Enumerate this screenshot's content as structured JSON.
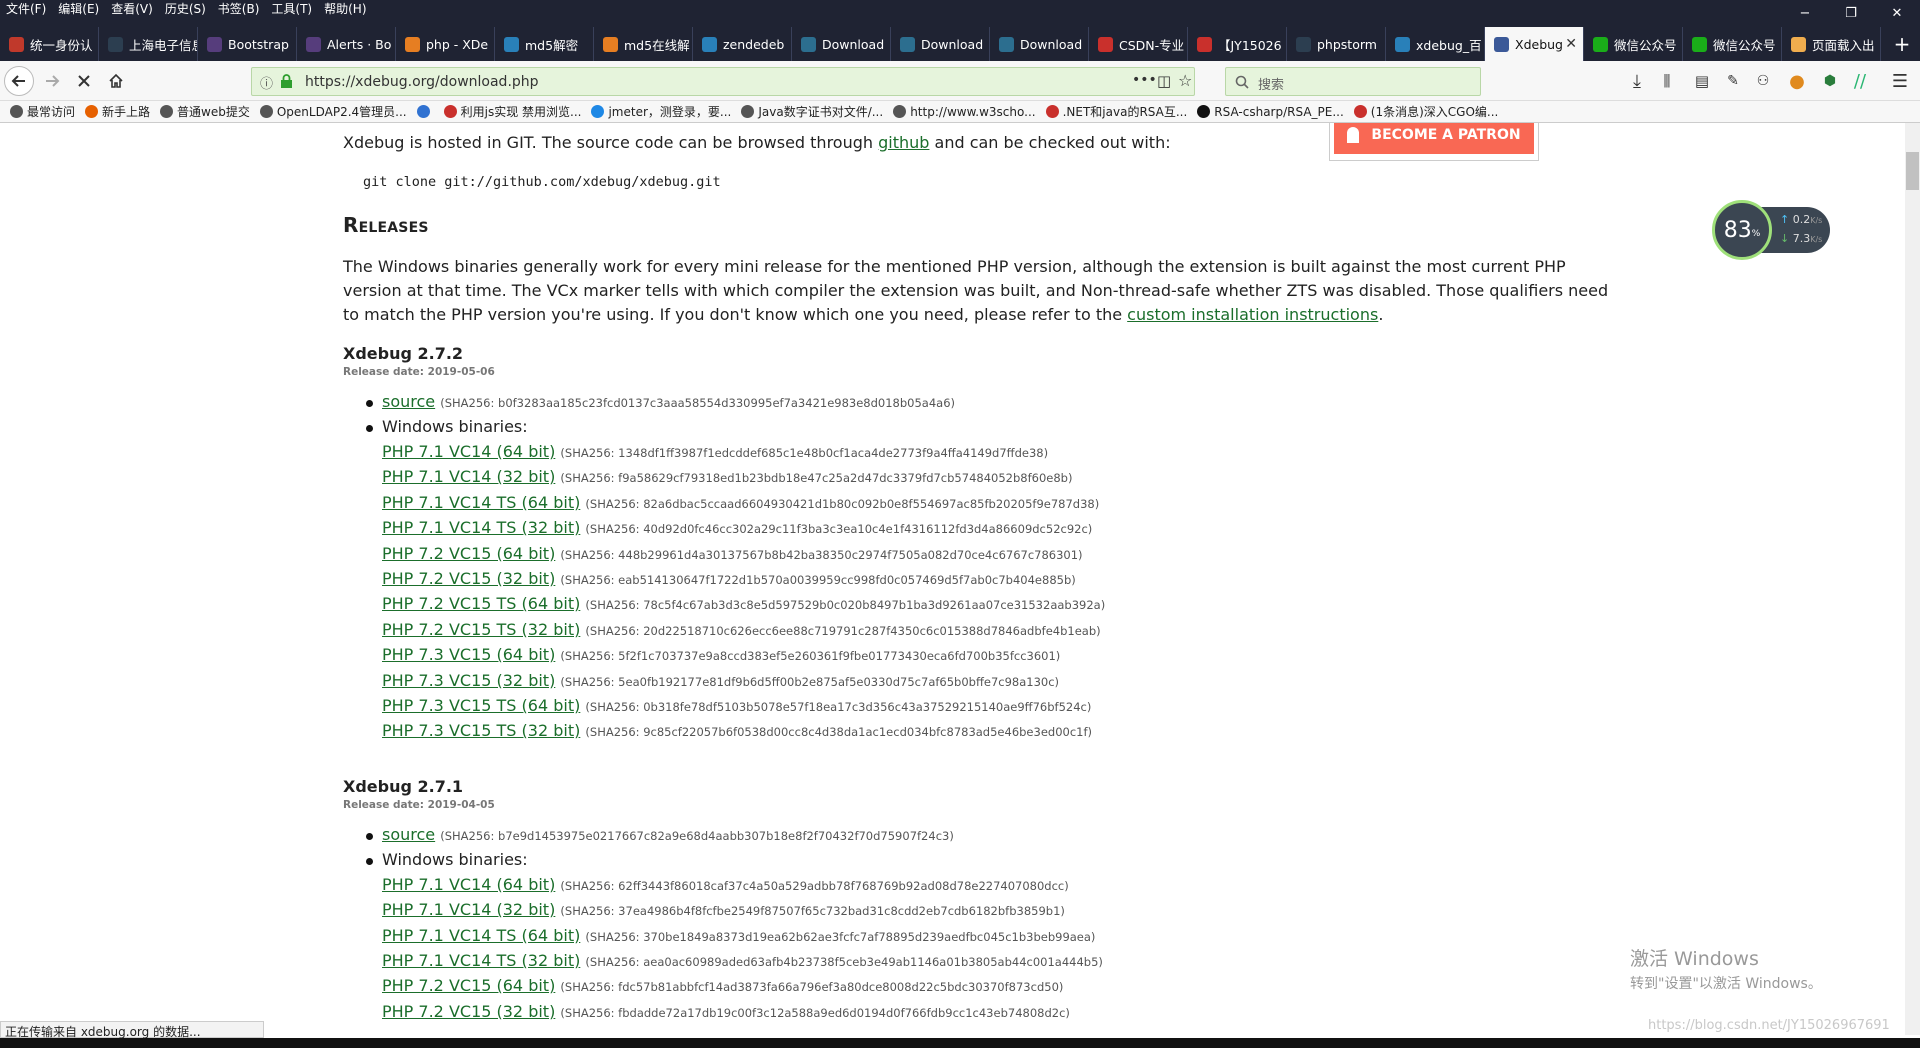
{
  "menu": [
    "文件(F)",
    "编辑(E)",
    "查看(V)",
    "历史(S)",
    "书签(B)",
    "工具(T)",
    "帮助(H)"
  ],
  "window_controls": {
    "minimize": "−",
    "restore": "❐",
    "close": "✕"
  },
  "tabs": [
    {
      "title": "统一身份认",
      "fav": "#c0392b"
    },
    {
      "title": "上海电子信息职",
      "fav": "#2c3e50"
    },
    {
      "title": "Bootstrap",
      "fav": "#563d7c"
    },
    {
      "title": "Alerts · Bo",
      "fav": "#563d7c"
    },
    {
      "title": "php - XDe",
      "fav": "#e67e22"
    },
    {
      "title": "md5解密",
      "fav": "#2980b9"
    },
    {
      "title": "md5在线解",
      "fav": "#e67e22"
    },
    {
      "title": "zendedeb",
      "fav": "#2980b9"
    },
    {
      "title": "Download",
      "fav": "#2c6e8f"
    },
    {
      "title": "Download",
      "fav": "#2c6e8f"
    },
    {
      "title": "Download",
      "fav": "#2c6e8f"
    },
    {
      "title": "CSDN-专业",
      "fav": "#c9302c"
    },
    {
      "title": "【JY15026",
      "fav": "#c9302c"
    },
    {
      "title": "phpstorm",
      "fav": "#2c3e50"
    },
    {
      "title": "xdebug_百",
      "fav": "#2980b9"
    },
    {
      "title": "Xdebug",
      "fav": "#3b5998",
      "active": true,
      "close": "✕"
    },
    {
      "title": "微信公众号",
      "fav": "#1aad19"
    },
    {
      "title": "微信公众号",
      "fav": "#1aad19"
    },
    {
      "title": "页面载入出",
      "fav": "#f0ad4e"
    }
  ],
  "newtab": "+",
  "nav": {
    "url": "https://xdebug.org/download.php",
    "search_placeholder": "搜索",
    "page_actions": "•••"
  },
  "bookmarks": [
    {
      "label": "最常访问",
      "c": "#555"
    },
    {
      "label": "新手上路",
      "c": "#e66000"
    },
    {
      "label": "普通web提交",
      "c": "#555"
    },
    {
      "label": "OpenLDAP2.4管理员...",
      "c": "#555"
    },
    {
      "label": "",
      "c": "#3072d1"
    },
    {
      "label": "利用js实现 禁用浏览...",
      "c": "#c9302c"
    },
    {
      "label": "jmeter，测登录，要...",
      "c": "#1e88e5"
    },
    {
      "label": "Java数字证书对文件/...",
      "c": "#555"
    },
    {
      "label": "http://www.w3scho...",
      "c": "#555"
    },
    {
      "label": ".NET和java的RSA互...",
      "c": "#c9302c"
    },
    {
      "label": "RSA-csharp/RSA_PE...",
      "c": "#111"
    },
    {
      "label": "(1条消息)深入CGO编...",
      "c": "#c9302c"
    }
  ],
  "page": {
    "git_text_before": "Xdebug is hosted in GIT. The source code can be browsed through ",
    "git_link": "github",
    "git_text_after": " and can be checked out with:",
    "git_cmd": "git clone git://github.com/xdebug/xdebug.git",
    "patron": "BECOME A PATRON",
    "releases_title": "Releases",
    "intro_1": "The Windows binaries generally work for every mini release for the mentioned PHP version, although the extension is built against the most current PHP",
    "intro_2": "version at that time. The VCx marker tells with which compiler the extension was built, and Non-thread-safe whether ZTS was disabled. Those qualifiers need",
    "intro_3a": "to match the PHP version you're using. If you don't know which one you need, please refer to the ",
    "intro_link": "custom installation instructions",
    "intro_3b": ".",
    "windows_binaries": "Windows binaries:",
    "releases": [
      {
        "version": "Xdebug 2.7.2",
        "date": "Release date: 2019-05-06",
        "source": {
          "label": "source",
          "hash": "(SHA256: b0f3283aa185c23fcd0137c3aaa58554d330995ef7a3421e983e8d018b05a4a6)"
        },
        "binaries": [
          {
            "label": "PHP 7.1 VC14 (64 bit)",
            "hash": "(SHA256: 1348df1ff3987f1edcddef685c1e48b0cf1aca4de2773f9a4ffa4149d7ffde38)"
          },
          {
            "label": "PHP 7.1 VC14 (32 bit)",
            "hash": "(SHA256: f9a58629cf79318ed1b23bdb18e47c25a2d47dc3379fd7cb57484052b8f60e8b)"
          },
          {
            "label": "PHP 7.1 VC14 TS (64 bit)",
            "hash": "(SHA256: 82a6dbac5ccaad6604930421d1b80c092b0e8f554697ac85fb20205f9e787d38)"
          },
          {
            "label": "PHP 7.1 VC14 TS (32 bit)",
            "hash": "(SHA256: 40d92d0fc46cc302a29c11f3ba3c3ea10c4e1f4316112fd3d4a86609dc52c92c)"
          },
          {
            "label": "PHP 7.2 VC15 (64 bit)",
            "hash": "(SHA256: 448b29961d4a30137567b8b42ba38350c2974f7505a082d70ce4c6767c786301)"
          },
          {
            "label": "PHP 7.2 VC15 (32 bit)",
            "hash": "(SHA256: eab514130647f1722d1b570a0039959cc998fd0c057469d5f7ab0c7b404e885b)"
          },
          {
            "label": "PHP 7.2 VC15 TS (64 bit)",
            "hash": "(SHA256: 78c5f4c67ab3d3c8e5d597529b0c020b8497b1ba3d9261aa07ce31532aab392a)"
          },
          {
            "label": "PHP 7.2 VC15 TS (32 bit)",
            "hash": "(SHA256: 20d22518710c626ecc6ee88c719791c287f4350c6c015388d7846adbfe4b1eab)"
          },
          {
            "label": "PHP 7.3 VC15 (64 bit)",
            "hash": "(SHA256: 5f2f1c703737e9a8ccd383ef5e260361f9fbe01773430eca6fd700b35fcc3601)"
          },
          {
            "label": "PHP 7.3 VC15 (32 bit)",
            "hash": "(SHA256: 5ea0fb192177e81df9b6d5ff00b2e875af5e0330d75c7af65b0bffe7c98a130c)"
          },
          {
            "label": "PHP 7.3 VC15 TS (64 bit)",
            "hash": "(SHA256: 0b318fe78df5103b5078e57f18ea17c3d356c43a37529215140ae9ff76bf524c)"
          },
          {
            "label": "PHP 7.3 VC15 TS (32 bit)",
            "hash": "(SHA256: 9c85cf22057b6f0538d00cc8c4d38da1ac1ecd034bfc8783ad5e46be3ed00c1f)"
          }
        ]
      },
      {
        "version": "Xdebug 2.7.1",
        "date": "Release date: 2019-04-05",
        "source": {
          "label": "source",
          "hash": "(SHA256: b7e9d1453975e0217667c82a9e68d4aabb307b18e8f2f70432f70d75907f24c3)"
        },
        "binaries": [
          {
            "label": "PHP 7.1 VC14 (64 bit)",
            "hash": "(SHA256: 62ff3443f86018caf37c4a50a529adbb78f768769b92ad08d78e227407080dcc)"
          },
          {
            "label": "PHP 7.1 VC14 (32 bit)",
            "hash": "(SHA256: 37ea4986b4f8fcfbe2549f87507f65c732bad31c8cdd2eb7cdb6182bfb3859b1)"
          },
          {
            "label": "PHP 7.1 VC14 TS (64 bit)",
            "hash": "(SHA256: 370be1849a8373d19ea62b62ae3fcfc7af78895d239aedfbc045c1b3beb99aea)"
          },
          {
            "label": "PHP 7.1 VC14 TS (32 bit)",
            "hash": "(SHA256: aea0ac60989aded63afb4b23738f5ceb3e49ab1146a01b3805ab44c001a444b5)"
          },
          {
            "label": "PHP 7.2 VC15 (64 bit)",
            "hash": "(SHA256: fdc57b81abbfcf14ad3873fa66a796ef3a80dce8008d22c5bdc30370f873cd50)"
          },
          {
            "label": "PHP 7.2 VC15 (32 bit)",
            "hash": "(SHA256: fbdadde72a17db19c00f3c12a588a9ed6d0194d0f766fdb9cc1c43eb74808d2c)"
          }
        ]
      }
    ]
  },
  "widget": {
    "percent": "83",
    "unit": "%",
    "up": "0.2",
    "down": "7.3",
    "rate_unit": "K/s"
  },
  "status": "正在传输来自 xdebug.org 的数据...",
  "windows_activation": {
    "title": "激活 Windows",
    "sub": "转到\"设置\"以激活 Windows。"
  },
  "watermark": "https://blog.csdn.net/JY15026967691"
}
